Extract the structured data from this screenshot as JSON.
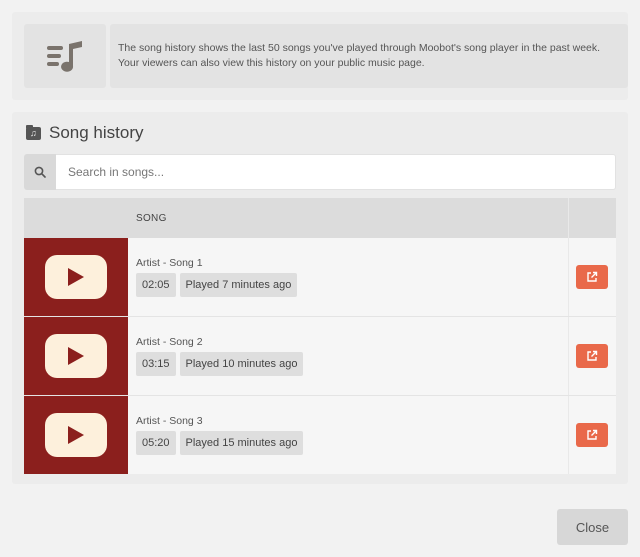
{
  "info": {
    "line1": "The song history shows the last 50 songs you've played through Moobot's song player in the past week.",
    "line2": "Your viewers can also view this history on your public music page.",
    "icon": "music-list-icon"
  },
  "history": {
    "title": "Song history",
    "title_icon": "music-folder-icon",
    "search": {
      "placeholder": "Search in songs...",
      "value": "",
      "icon": "search-icon"
    },
    "columns": {
      "thumbnail": "",
      "song": "SONG",
      "action": ""
    },
    "rows": [
      {
        "title": "Artist - Song 1",
        "duration": "02:05",
        "played": "Played 7 minutes ago"
      },
      {
        "title": "Artist - Song 2",
        "duration": "03:15",
        "played": "Played 10 minutes ago"
      },
      {
        "title": "Artist - Song 3",
        "duration": "05:20",
        "played": "Played 15 minutes ago"
      }
    ]
  },
  "footer": {
    "close_label": "Close"
  },
  "colors": {
    "thumbnail_bg": "#8b1f1d",
    "play_button": "#fdf0dc",
    "accent": "#e9694a"
  }
}
